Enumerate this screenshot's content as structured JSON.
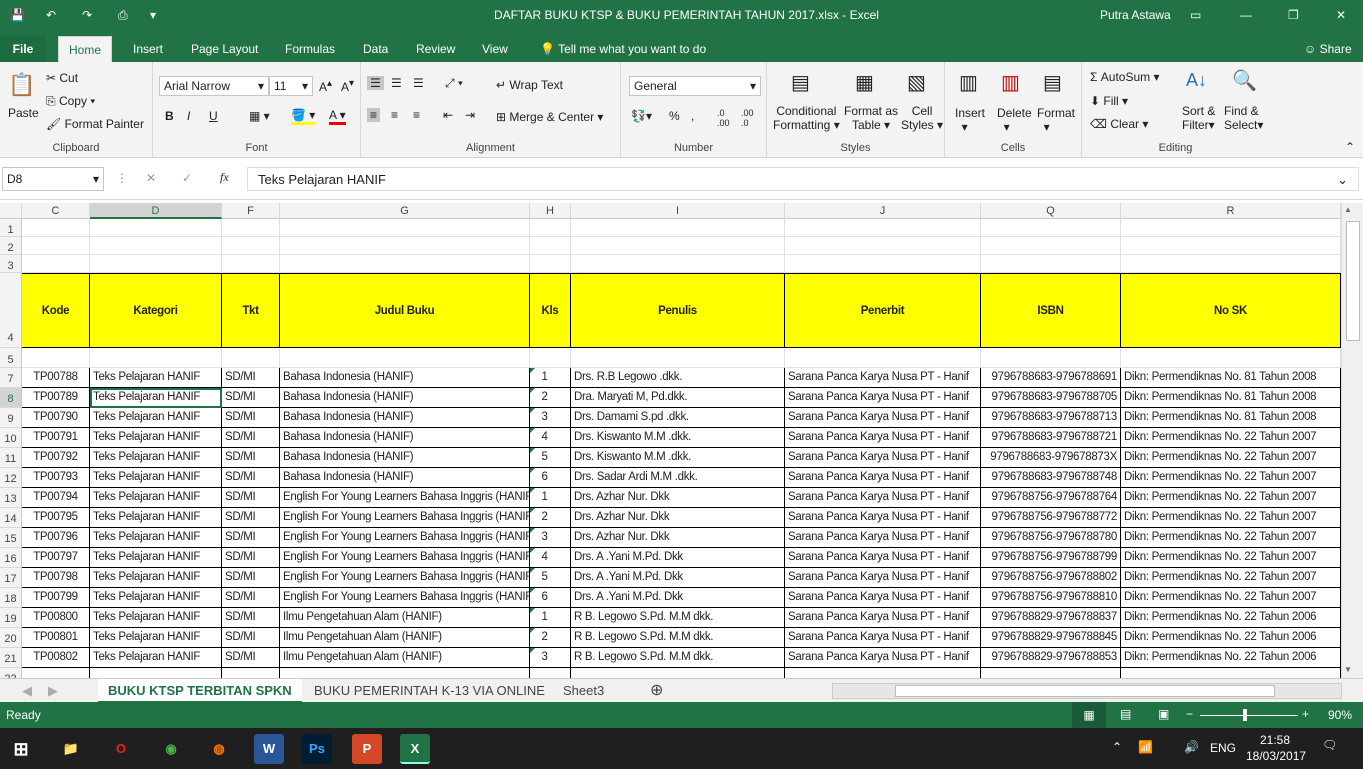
{
  "window": {
    "title": "DAFTAR BUKU KTSP  &  BUKU  PEMERINTAH TAHUN 2017.xlsx  -  Excel",
    "user": "Putra Astawa"
  },
  "ribbon_tabs": [
    "File",
    "Home",
    "Insert",
    "Page Layout",
    "Formulas",
    "Data",
    "Review",
    "View"
  ],
  "tell_me": "Tell me what you want to do",
  "share": "Share",
  "clipboard": {
    "paste": "Paste",
    "cut": "Cut",
    "copy": "Copy",
    "format_painter": "Format Painter",
    "label": "Clipboard"
  },
  "font": {
    "name": "Arial Narrow",
    "size": "11",
    "label": "Font",
    "bold": "B",
    "italic": "I",
    "underline": "U"
  },
  "alignment": {
    "wrap": "Wrap Text",
    "merge": "Merge & Center",
    "label": "Alignment"
  },
  "number": {
    "format": "General",
    "label": "Number"
  },
  "styles": {
    "conditional": "Conditional",
    "conditional2": "Formatting",
    "format_as": "Format as",
    "format_as2": "Table",
    "cell": "Cell",
    "cell2": "Styles",
    "label": "Styles"
  },
  "cells": {
    "insert": "Insert",
    "delete": "Delete",
    "format": "Format",
    "label": "Cells"
  },
  "editing": {
    "autosum": "AutoSum",
    "fill": "Fill",
    "clear": "Clear",
    "sort": "Sort &",
    "sort2": "Filter",
    "find": "Find &",
    "find2": "Select",
    "label": "Editing"
  },
  "formula_bar": {
    "name_box": "D8",
    "fx": "fx",
    "value": "Teks Pelajaran HANIF"
  },
  "columns": [
    "C",
    "D",
    "F",
    "G",
    "H",
    "I",
    "J",
    "Q",
    "R"
  ],
  "headers": [
    "Kode",
    "Kategori",
    "Tkt",
    "Judul Buku",
    "Kls",
    "Penulis",
    "Penerbit",
    "ISBN",
    "No SK"
  ],
  "rows": [
    [
      "7",
      "TP00788",
      "Teks Pelajaran HANIF",
      "SD/MI",
      "Bahasa Indonesia (HANIF)",
      "1",
      "Drs. R.B Legowo .dkk.",
      "Sarana Panca Karya Nusa PT - Hanif",
      "9796788683-9796788691",
      "Dikn: Permendiknas No. 81 Tahun 2008"
    ],
    [
      "8",
      "TP00789",
      "Teks Pelajaran HANIF",
      "SD/MI",
      "Bahasa Indonesia (HANIF)",
      "2",
      "Dra. Maryati M, Pd.dkk.",
      "Sarana Panca Karya Nusa PT - Hanif",
      "9796788683-9796788705",
      "Dikn: Permendiknas No. 81 Tahun 2008"
    ],
    [
      "9",
      "TP00790",
      "Teks Pelajaran HANIF",
      "SD/MI",
      "Bahasa Indonesia (HANIF)",
      "3",
      "Drs. Damami S.pd .dkk.",
      "Sarana Panca Karya Nusa PT - Hanif",
      "9796788683-9796788713",
      "Dikn: Permendiknas No. 81 Tahun 2008"
    ],
    [
      "10",
      "TP00791",
      "Teks Pelajaran HANIF",
      "SD/MI",
      "Bahasa Indonesia (HANIF)",
      "4",
      "Drs. Kiswanto M.M .dkk.",
      "Sarana Panca Karya Nusa PT - Hanif",
      "9796788683-9796788721",
      "Dikn: Permendiknas No. 22 Tahun 2007"
    ],
    [
      "11",
      "TP00792",
      "Teks Pelajaran HANIF",
      "SD/MI",
      "Bahasa Indonesia (HANIF)",
      "5",
      "Drs. Kiswanto M.M .dkk.",
      "Sarana Panca Karya Nusa PT - Hanif",
      "9796788683-979678873X",
      "Dikn: Permendiknas No. 22 Tahun 2007"
    ],
    [
      "12",
      "TP00793",
      "Teks Pelajaran HANIF",
      "SD/MI",
      "Bahasa Indonesia (HANIF)",
      "6",
      "Drs. Sadar Ardi M.M .dkk.",
      "Sarana Panca Karya Nusa PT - Hanif",
      "9796788683-9796788748",
      "Dikn: Permendiknas No. 22 Tahun 2007"
    ],
    [
      "13",
      "TP00794",
      "Teks Pelajaran HANIF",
      "SD/MI",
      "English For Young Learners Bahasa Inggris (HANIF)",
      "1",
      "Drs. Azhar Nur. Dkk",
      "Sarana Panca Karya Nusa PT - Hanif",
      "9796788756-9796788764",
      "Dikn: Permendiknas No. 22 Tahun 2007"
    ],
    [
      "14",
      "TP00795",
      "Teks Pelajaran HANIF",
      "SD/MI",
      "English For Young Learners Bahasa Inggris (HANIF)",
      "2",
      "Drs. Azhar Nur. Dkk",
      "Sarana Panca Karya Nusa PT - Hanif",
      "9796788756-9796788772",
      "Dikn: Permendiknas No. 22 Tahun 2007"
    ],
    [
      "15",
      "TP00796",
      "Teks Pelajaran HANIF",
      "SD/MI",
      "English For Young Learners Bahasa Inggris (HANIF)",
      "3",
      "Drs. Azhar Nur. Dkk",
      "Sarana Panca Karya Nusa PT - Hanif",
      "9796788756-9796788780",
      "Dikn: Permendiknas No. 22 Tahun 2007"
    ],
    [
      "16",
      "TP00797",
      "Teks Pelajaran HANIF",
      "SD/MI",
      "English For Young Learners Bahasa Inggris (HANIF)",
      "4",
      "Drs. A .Yani M.Pd. Dkk",
      "Sarana Panca Karya Nusa PT - Hanif",
      "9796788756-9796788799",
      "Dikn: Permendiknas No. 22 Tahun 2007"
    ],
    [
      "17",
      "TP00798",
      "Teks Pelajaran HANIF",
      "SD/MI",
      "English For Young Learners Bahasa Inggris (HANIF)",
      "5",
      "Drs. A .Yani M.Pd. Dkk",
      "Sarana Panca Karya Nusa PT - Hanif",
      "9796788756-9796788802",
      "Dikn: Permendiknas No. 22 Tahun 2007"
    ],
    [
      "18",
      "TP00799",
      "Teks Pelajaran HANIF",
      "SD/MI",
      "English For Young Learners Bahasa Inggris (HANIF)",
      "6",
      "Drs. A .Yani M.Pd. Dkk",
      "Sarana Panca Karya Nusa PT - Hanif",
      "9796788756-9796788810",
      "Dikn: Permendiknas No. 22 Tahun 2007"
    ],
    [
      "19",
      "TP00800",
      "Teks Pelajaran HANIF",
      "SD/MI",
      "Ilmu Pengetahuan Alam (HANIF)",
      "1",
      "R B. Legowo S.Pd. M.M dkk.",
      "Sarana Panca Karya Nusa PT - Hanif",
      "9796788829-9796788837",
      "Dikn: Permendiknas No. 22 Tahun 2006"
    ],
    [
      "20",
      "TP00801",
      "Teks Pelajaran HANIF",
      "SD/MI",
      "Ilmu Pengetahuan Alam (HANIF)",
      "2",
      "R B. Legowo S.Pd. M.M dkk.",
      "Sarana Panca Karya Nusa PT - Hanif",
      "9796788829-9796788845",
      "Dikn: Permendiknas No. 22 Tahun 2006"
    ],
    [
      "21",
      "TP00802",
      "Teks Pelajaran HANIF",
      "SD/MI",
      "Ilmu Pengetahuan Alam (HANIF)",
      "3",
      "R B. Legowo S.Pd. M.M dkk.",
      "Sarana Panca Karya Nusa PT - Hanif",
      "9796788829-9796788853",
      "Dikn: Permendiknas No. 22 Tahun 2006"
    ]
  ],
  "sheets": [
    "BUKU KTSP TERBITAN SPKN",
    "BUKU PEMERINTAH K-13 VIA ONLINE",
    "Sheet3"
  ],
  "status": {
    "ready": "Ready",
    "zoom": "90%"
  },
  "taskbar": {
    "time": "21:58",
    "date": "18/03/2017",
    "lang": "ENG"
  },
  "colors": {
    "excel_green": "#217346",
    "header_fill": "#ffff00"
  }
}
